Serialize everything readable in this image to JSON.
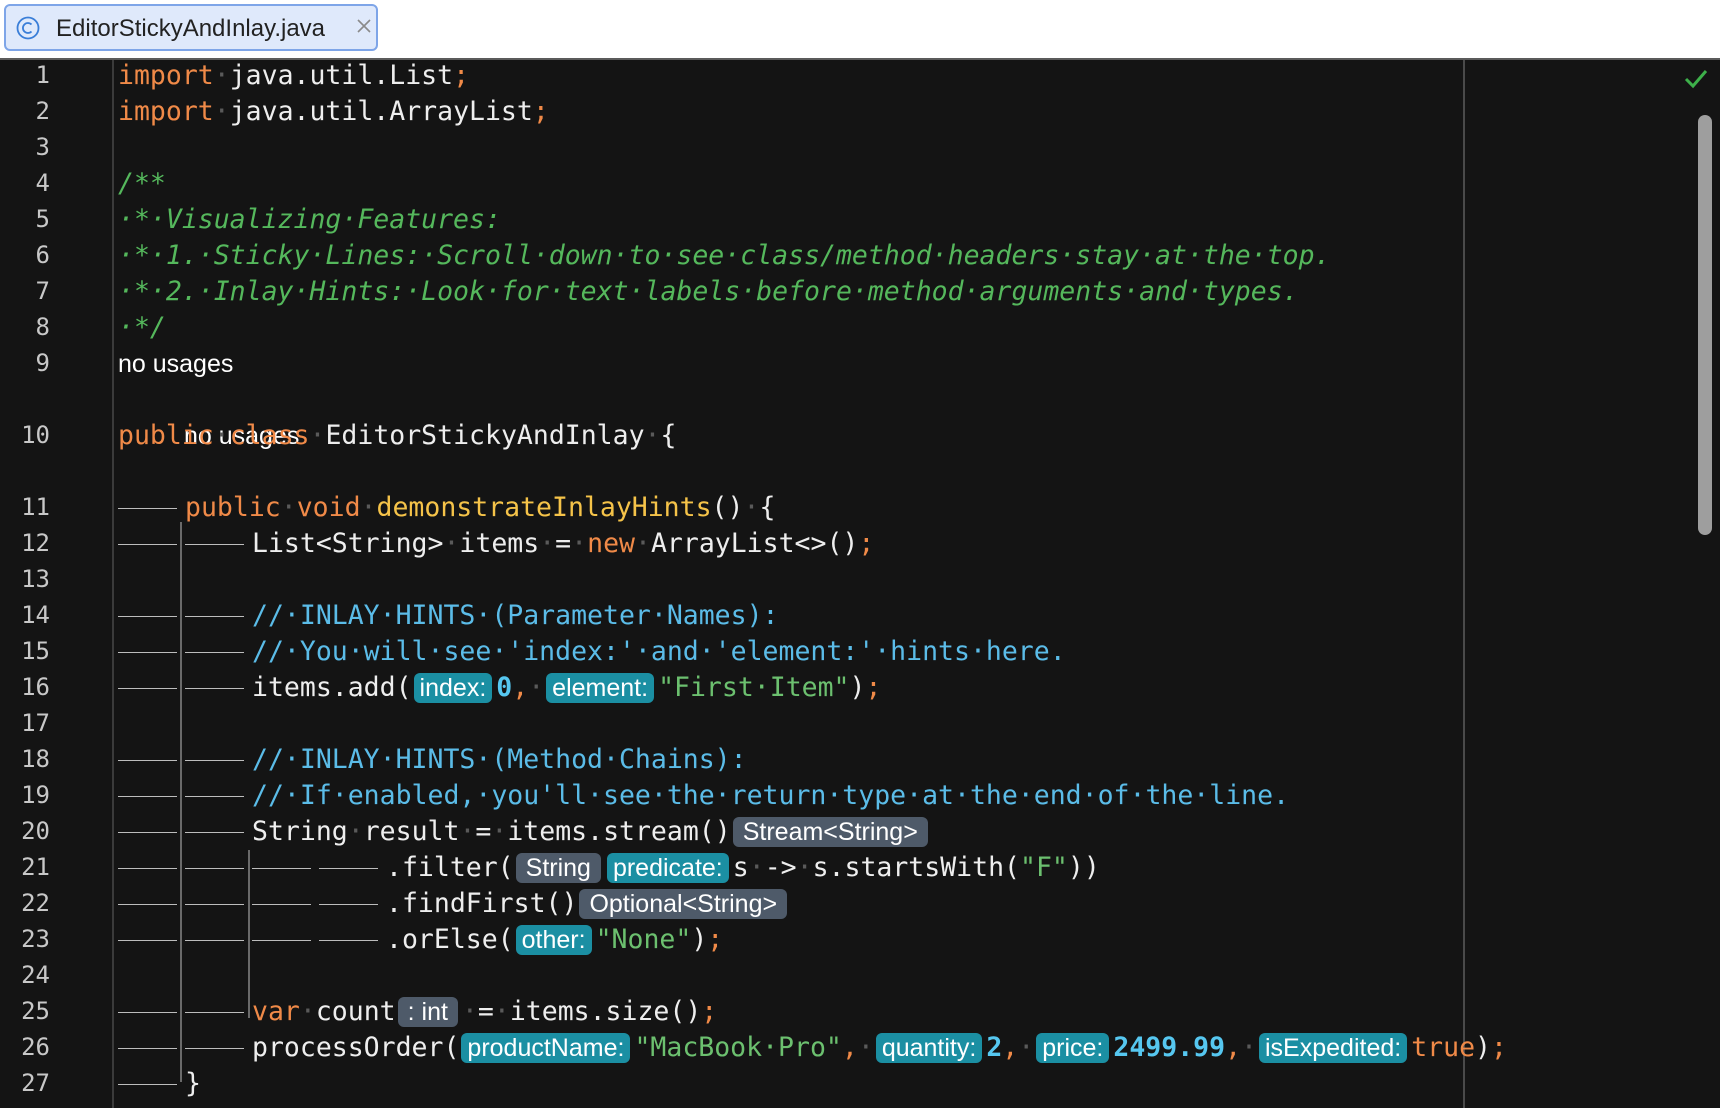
{
  "tab": {
    "title": "EditorStickyAndInlay.java",
    "icon": "class-c-icon"
  },
  "status": {
    "icon": "checkmark-icon",
    "color": "#3db04a"
  },
  "colors": {
    "keyword": "#f08a48",
    "comment": "#55b85c",
    "line_comment": "#5bbce8",
    "string": "#6cc06f",
    "function": "#f5c349",
    "number": "#56c7f0",
    "param_hint_bg": "#1b8fa3",
    "type_hint_bg": "#4e5a69"
  },
  "code_lens": {
    "class_usages": "no usages",
    "method_usages": "no usages"
  },
  "lines": [
    {
      "no": "1",
      "t": [
        [
          "k",
          "import"
        ],
        [
          "sp",
          "·"
        ],
        [
          "",
          "java.util.List"
        ],
        [
          "k",
          ";"
        ]
      ]
    },
    {
      "no": "2",
      "t": [
        [
          "k",
          "import"
        ],
        [
          "sp",
          "·"
        ],
        [
          "",
          "java.util.ArrayList"
        ],
        [
          "k",
          ";"
        ]
      ]
    },
    {
      "no": "3",
      "t": []
    },
    {
      "no": "4",
      "t": [
        [
          "c",
          "/**"
        ]
      ]
    },
    {
      "no": "5",
      "t": [
        [
          "c",
          "·*·Visualizing·Features:"
        ]
      ]
    },
    {
      "no": "6",
      "t": [
        [
          "c",
          "·*·1.·Sticky·Lines:·Scroll·down·to·see·class/method·headers·stay·at·the·top."
        ]
      ]
    },
    {
      "no": "7",
      "t": [
        [
          "c",
          "·*·2.·Inlay·Hints:·Look·for·text·labels·before·method·arguments·and·types."
        ]
      ]
    },
    {
      "no": "8",
      "t": [
        [
          "c",
          "·*/"
        ]
      ]
    },
    {
      "no": "9",
      "t": []
    },
    {
      "no": "10",
      "t": [
        [
          "k",
          "public"
        ],
        [
          "sp",
          "·"
        ],
        [
          "k",
          "class"
        ],
        [
          "sp",
          "·"
        ],
        [
          "",
          "EditorStickyAndInlay"
        ],
        [
          "sp",
          "·"
        ],
        [
          "",
          "{"
        ]
      ]
    },
    {
      "no": "11",
      "t": [
        [
          "g1",
          ""
        ],
        [
          "k",
          "public"
        ],
        [
          "sp",
          "·"
        ],
        [
          "k",
          "void"
        ],
        [
          "sp",
          "·"
        ],
        [
          "f",
          "demonstrateInlayHints"
        ],
        [
          "",
          "()"
        ],
        [
          "sp",
          "·"
        ],
        [
          "",
          "{"
        ]
      ]
    },
    {
      "no": "12",
      "t": [
        [
          "g1",
          ""
        ],
        [
          "g1",
          ""
        ],
        [
          "",
          "List<String>"
        ],
        [
          "sp",
          "·"
        ],
        [
          "",
          "items"
        ],
        [
          "sp",
          "·"
        ],
        [
          "",
          "="
        ],
        [
          "sp",
          "·"
        ],
        [
          "k",
          "new"
        ],
        [
          "sp",
          "·"
        ],
        [
          "",
          "ArrayList<>()"
        ],
        [
          "k",
          ";"
        ]
      ]
    },
    {
      "no": "13",
      "t": []
    },
    {
      "no": "14",
      "t": [
        [
          "g1",
          ""
        ],
        [
          "g1",
          ""
        ],
        [
          "lc",
          "//·INLAY·HINTS·(Parameter·Names):"
        ]
      ]
    },
    {
      "no": "15",
      "t": [
        [
          "g1",
          ""
        ],
        [
          "g1",
          ""
        ],
        [
          "lc",
          "//·You·will·see·'index:'·and·'element:'·hints·here."
        ]
      ]
    },
    {
      "no": "16",
      "t": [
        [
          "g1",
          ""
        ],
        [
          "g1",
          ""
        ],
        [
          "",
          "items.add("
        ],
        [
          "h",
          "index:"
        ],
        [
          "n",
          "0"
        ],
        [
          "k",
          ","
        ],
        [
          "sp",
          "·"
        ],
        [
          "h",
          "element:"
        ],
        [
          "s",
          "\"First·Item\""
        ],
        [
          "",
          ")"
        ],
        [
          "k",
          ";"
        ]
      ]
    },
    {
      "no": "17",
      "t": []
    },
    {
      "no": "18",
      "t": [
        [
          "g1",
          ""
        ],
        [
          "g1",
          ""
        ],
        [
          "lc",
          "//·INLAY·HINTS·(Method·Chains):"
        ]
      ]
    },
    {
      "no": "19",
      "t": [
        [
          "g1",
          ""
        ],
        [
          "g1",
          ""
        ],
        [
          "lc",
          "//·If·enabled,·you'll·see·the·return·type·at·the·end·of·the·line."
        ]
      ]
    },
    {
      "no": "20",
      "t": [
        [
          "g1",
          ""
        ],
        [
          "g1",
          ""
        ],
        [
          "",
          "String"
        ],
        [
          "sp",
          "·"
        ],
        [
          "",
          "result"
        ],
        [
          "sp",
          "·"
        ],
        [
          "",
          "="
        ],
        [
          "sp",
          "·"
        ],
        [
          "",
          "items.stream()"
        ],
        [
          "th",
          "Stream<String>"
        ]
      ]
    },
    {
      "no": "21",
      "t": [
        [
          "g1",
          ""
        ],
        [
          "g1",
          ""
        ],
        [
          "g1",
          ""
        ],
        [
          "g1",
          ""
        ],
        [
          "",
          ".filter("
        ],
        [
          "th",
          "String"
        ],
        [
          "h",
          "predicate:"
        ],
        [
          "",
          "s"
        ],
        [
          "sp",
          "·"
        ],
        [
          "",
          "->"
        ],
        [
          "sp",
          "·"
        ],
        [
          "",
          "s.startsWith("
        ],
        [
          "s",
          "\"F\""
        ],
        [
          "",
          "))"
        ]
      ]
    },
    {
      "no": "22",
      "t": [
        [
          "g1",
          ""
        ],
        [
          "g1",
          ""
        ],
        [
          "g1",
          ""
        ],
        [
          "g1",
          ""
        ],
        [
          "",
          ".findFirst()"
        ],
        [
          "th",
          "Optional<String>"
        ]
      ]
    },
    {
      "no": "23",
      "t": [
        [
          "g1",
          ""
        ],
        [
          "g1",
          ""
        ],
        [
          "g1",
          ""
        ],
        [
          "g1",
          ""
        ],
        [
          "",
          ".orElse("
        ],
        [
          "h",
          "other:"
        ],
        [
          "s",
          "\"None\""
        ],
        [
          "",
          ")"
        ],
        [
          "k",
          ";"
        ]
      ]
    },
    {
      "no": "24",
      "t": []
    },
    {
      "no": "25",
      "t": [
        [
          "g1",
          ""
        ],
        [
          "g1",
          ""
        ],
        [
          "k",
          "var"
        ],
        [
          "sp",
          "·"
        ],
        [
          "",
          "count"
        ],
        [
          "th",
          ": int"
        ],
        [
          "sp",
          "·"
        ],
        [
          "",
          "="
        ],
        [
          "sp",
          "·"
        ],
        [
          "",
          "items.size()"
        ],
        [
          "k",
          ";"
        ]
      ]
    },
    {
      "no": "26",
      "t": [
        [
          "g1",
          ""
        ],
        [
          "g1",
          ""
        ],
        [
          "",
          "processOrder("
        ],
        [
          "h",
          "productName:"
        ],
        [
          "s",
          "\"MacBook·Pro\""
        ],
        [
          "k",
          ","
        ],
        [
          "sp",
          "·"
        ],
        [
          "h",
          "quantity:"
        ],
        [
          "n",
          "2"
        ],
        [
          "k",
          ","
        ],
        [
          "sp",
          "·"
        ],
        [
          "h",
          "price:"
        ],
        [
          "n",
          "2499.99"
        ],
        [
          "k",
          ","
        ],
        [
          "sp",
          "·"
        ],
        [
          "h",
          "isExpedited:"
        ],
        [
          "k",
          "true"
        ],
        [
          "",
          ")"
        ],
        [
          "k",
          ";"
        ]
      ]
    },
    {
      "no": "27",
      "t": [
        [
          "g1",
          ""
        ],
        [
          "",
          "}"
        ]
      ]
    }
  ]
}
